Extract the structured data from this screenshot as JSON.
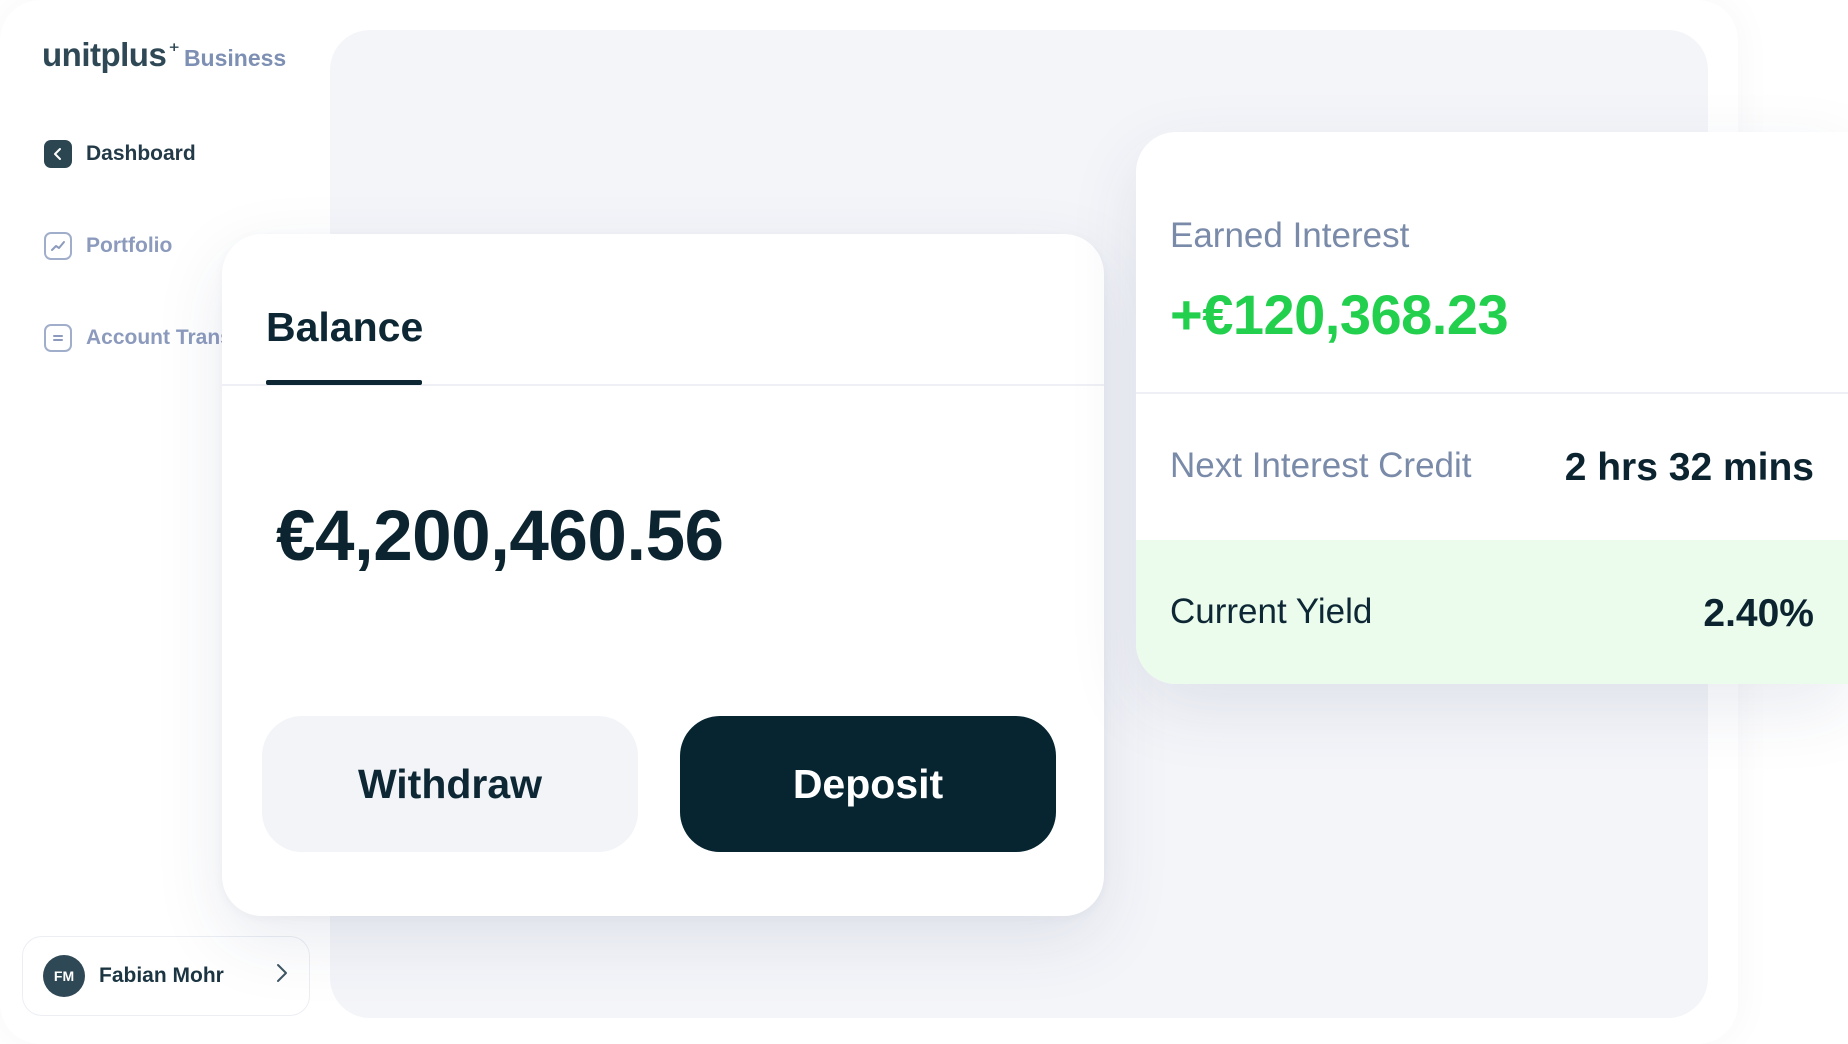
{
  "brand": {
    "name": "unitplus",
    "spark": "⁺",
    "sub": "Business"
  },
  "sidebar": {
    "items": [
      {
        "label": "Dashboard",
        "icon": "dashboard-icon"
      },
      {
        "label": "Portfolio",
        "icon": "chart-trend-icon"
      },
      {
        "label": "Account Transactions",
        "icon": "transactions-icon"
      }
    ],
    "user": {
      "initials": "FM",
      "name": "Fabian Mohr"
    }
  },
  "balance": {
    "tab_label": "Balance",
    "amount": "€4,200,460.56",
    "withdraw_label": "Withdraw",
    "deposit_label": "Deposit"
  },
  "interest": {
    "earned_label": "Earned Interest",
    "earned_value": "+€120,368.23",
    "next_label": "Next Interest Credit",
    "next_value": "2 hrs 32 mins",
    "yield_label": "Current Yield",
    "yield_value": "2.40%"
  },
  "colors": {
    "brand_dark": "#062530",
    "positive_green": "#22d04d",
    "yield_bg": "#ebfbec",
    "muted_text": "#7a8aa9"
  }
}
